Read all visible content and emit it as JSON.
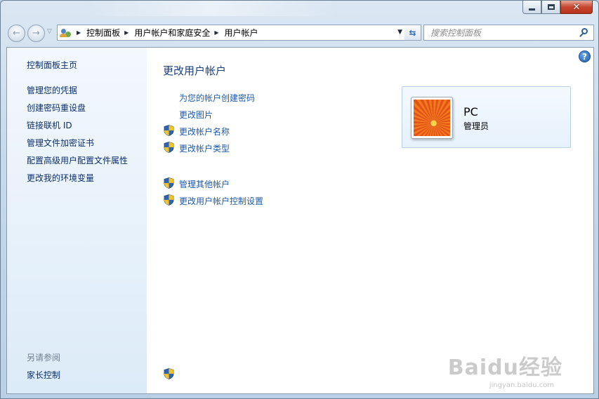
{
  "window": {
    "min_glyph": "",
    "close_glyph": "✕"
  },
  "nav": {
    "breadcrumbs": [
      "控制面板",
      "用户帐户和家庭安全",
      "用户帐户"
    ],
    "search_placeholder": "搜索控制面板"
  },
  "sidebar": {
    "home": "控制面板主页",
    "links": [
      "管理您的凭据",
      "创建密码重设盘",
      "链接联机 ID",
      "管理文件加密证书",
      "配置高级用户配置文件属性",
      "更改我的环境变量"
    ],
    "see_also_title": "另请参阅",
    "see_also_items": [
      "家长控制"
    ]
  },
  "main": {
    "title": "更改用户帐户",
    "tasks": [
      "为您的帐户创建密码",
      "更改图片",
      "更改帐户名称",
      "更改帐户类型"
    ],
    "other_tasks": [
      "管理其他帐户",
      "更改用户帐户控制设置"
    ]
  },
  "user": {
    "name": "PC",
    "role": "管理员"
  },
  "help": "?",
  "watermark": {
    "logo": "Baidu经验",
    "url": "jingyan.baidu.com"
  },
  "colors": {
    "link": "#1e5aa8",
    "sidebar_link": "#0c2f6d",
    "title": "#1a3e7a"
  }
}
